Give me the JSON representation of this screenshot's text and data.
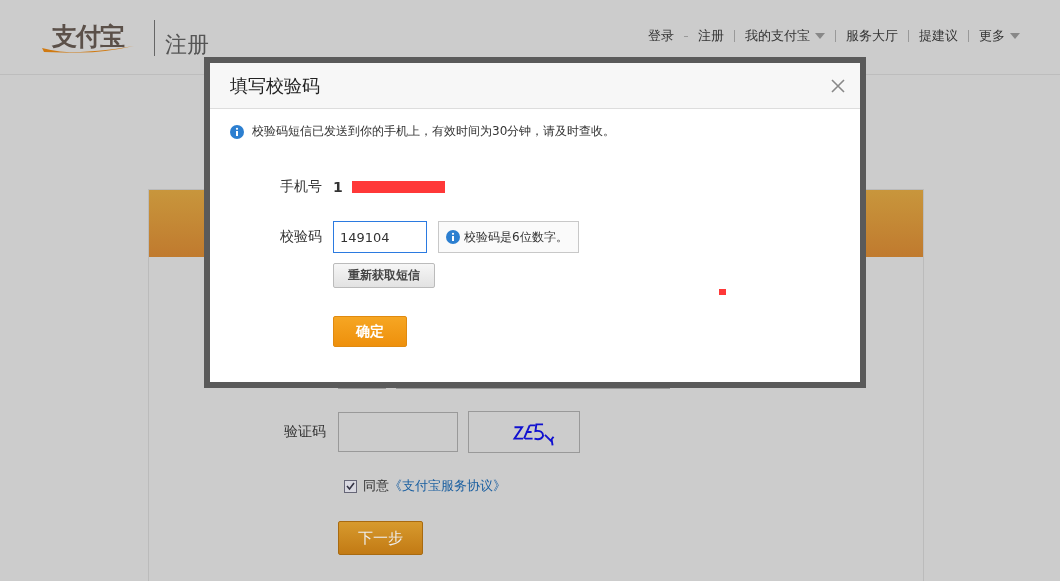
{
  "header": {
    "logo_text": "支付宝",
    "page_title": "注册",
    "nav_groups": [
      [
        {
          "label": "登录",
          "dropdown": false
        },
        {
          "label": "注册",
          "dropdown": false
        }
      ],
      [
        {
          "label": "我的支付宝",
          "dropdown": true
        }
      ],
      [
        {
          "label": "服务大厅",
          "dropdown": false
        }
      ],
      [
        {
          "label": "提建议",
          "dropdown": false
        }
      ],
      [
        {
          "label": "更多",
          "dropdown": true
        }
      ]
    ]
  },
  "registration_form": {
    "captcha_label": "验证码",
    "agreement": {
      "checked": true,
      "text": "同意",
      "link": "《支付宝服务协议》"
    },
    "next_button": "下一步"
  },
  "dialog": {
    "title": "填写校验码",
    "notice": "校验码短信已发送到你的手机上，有效时间为30分钟，请及时查收。",
    "phone_label": "手机号",
    "phone_value": "1",
    "code_label": "校验码",
    "code_value": "149104",
    "code_hint": "校验码是6位数字。",
    "resend_button": "重新获取短信",
    "confirm_button": "确定"
  }
}
